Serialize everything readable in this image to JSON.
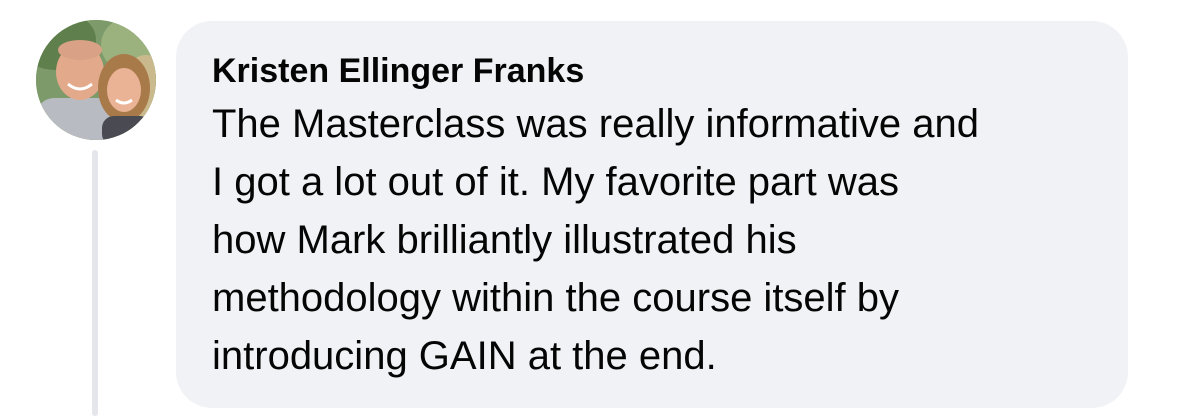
{
  "comment": {
    "author": "Kristen Ellinger Franks",
    "text_lines": [
      "The Masterclass was really informative and",
      "I got a lot out of it. My favorite part was",
      "how Mark brilliantly illustrated his",
      "methodology within the course itself by",
      "introducing GAIN at the end."
    ]
  },
  "colors": {
    "bubble_background": "#f0f2f5",
    "text": "#050505",
    "thread_line": "#e4e6eb"
  },
  "icons": {
    "avatar": "profile-photo-avatar"
  }
}
